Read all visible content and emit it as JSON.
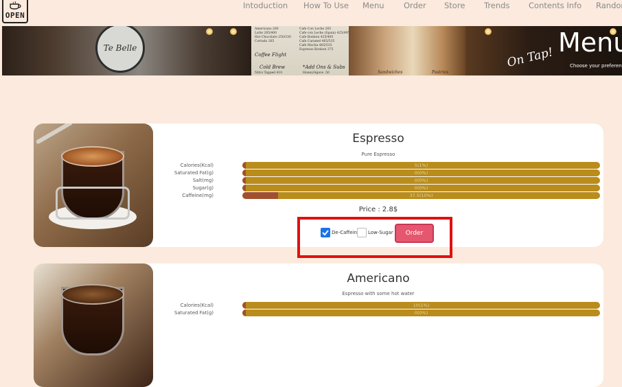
{
  "nav": {
    "logo_text": "OPEN",
    "links": [
      "Intoduction",
      "How To Use",
      "Menu",
      "Order",
      "Store",
      "Trends",
      "Contents Info",
      "Random"
    ]
  },
  "banner": {
    "title": "Menu",
    "subtitle": "Choose your preference",
    "left_sign": "Te Belle",
    "board_items": [
      "Americano 260",
      "Latte 285/400",
      "Hot Chocolate 250/330",
      "Cortado 265",
      "Cafe Con Leche 265",
      "Cafe con Leche (Spain) 425/495",
      "Cafe Bonbon 425/495",
      "Cafe Caramel 465/535",
      "Cafe Mocha 465/535",
      "Espresso Bonbon 375"
    ],
    "board_heads": [
      "Coffee Flight",
      "Cold Brew",
      "*Add Ons & Subs"
    ],
    "board_footer": [
      "Nitro Tapped 410",
      "Honey/Agave .50"
    ],
    "p3_labels": [
      "Sandwiches",
      "Pastries"
    ],
    "on_tap": "On Tap!"
  },
  "items": [
    {
      "name": "Espresso",
      "description": "Pure Espresso",
      "nutrition": [
        {
          "label": "Calories(Kcal)",
          "value_text": "5(1%)",
          "percent": 1
        },
        {
          "label": "Saturated Fat(g)",
          "value_text": "0(0%)",
          "percent": 0
        },
        {
          "label": "Salt(mg)",
          "value_text": "0(0%)",
          "percent": 0
        },
        {
          "label": "Sugar(g)",
          "value_text": "0(0%)",
          "percent": 0
        },
        {
          "label": "Caffeine(mg)",
          "value_text": "37.5(10%)",
          "percent": 10
        }
      ],
      "price": "Price : 2.8$",
      "options": {
        "decaf_label": "De-Caffeine",
        "decaf_checked": true,
        "lowsugar_label": "Low-Sugar",
        "lowsugar_checked": false
      },
      "order_label": "Order"
    },
    {
      "name": "Americano",
      "description": "Espresso with some hot water",
      "nutrition": [
        {
          "label": "Calories(Kcal)",
          "value_text": "10(1%)",
          "percent": 1
        },
        {
          "label": "Saturated Fat(g)",
          "value_text": "0(0%)",
          "percent": 0
        }
      ]
    }
  ],
  "colors": {
    "background": "#fbeadd",
    "bar": "#b98c1c",
    "bar_fill": "#a0502f",
    "order_button": "#e5576f",
    "checkbox_on": "#1a73e8",
    "highlight": "#e01010"
  }
}
